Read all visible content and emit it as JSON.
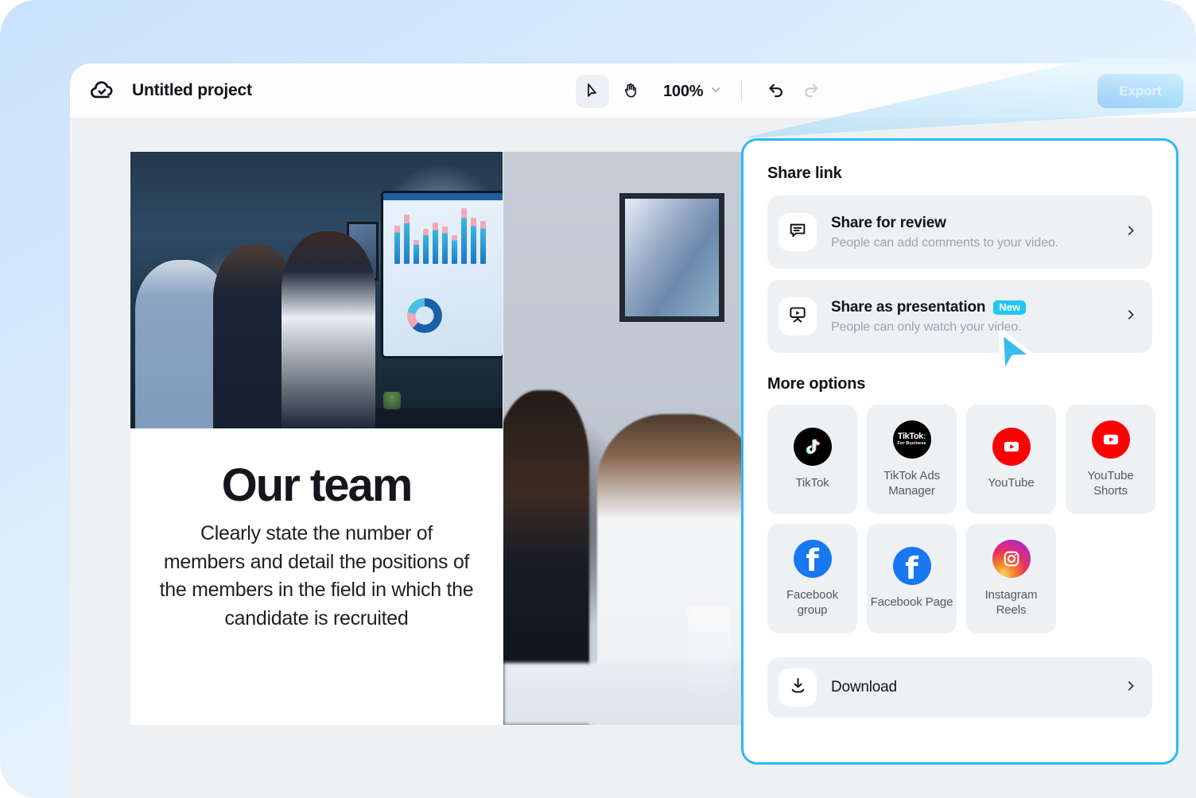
{
  "app": {
    "title": "Untitled project",
    "cloud_icon": "cloud-check-icon"
  },
  "toolbar": {
    "select_tool": "cursor-select-icon",
    "hand_tool": "hand-pan-icon",
    "zoom_value": "100%",
    "zoom_chevron": "chevron-down-icon",
    "undo": "undo-icon",
    "redo": "redo-icon",
    "export_label": "Export"
  },
  "canvas": {
    "slide1": {
      "heading": "Our team",
      "body": "Clearly state the number of members and detail the positions of the members in the field in which the candidate is recruited"
    }
  },
  "share_panel": {
    "heading": "Share link",
    "options": [
      {
        "icon": "comment-bubble-icon",
        "title": "Share for review",
        "subtitle": "People can add comments to your video.",
        "badge": "",
        "chevron": "chevron-right-icon"
      },
      {
        "icon": "presentation-play-icon",
        "title": "Share as presentation",
        "subtitle": "People can only watch your video.",
        "badge": "New",
        "chevron": "chevron-right-icon"
      }
    ],
    "more_options_heading": "More options",
    "social": [
      {
        "icon": "tiktok-icon",
        "label": "TikTok"
      },
      {
        "icon": "tiktok-for-business-icon",
        "label": "TikTok Ads Manager"
      },
      {
        "icon": "youtube-icon",
        "label": "YouTube"
      },
      {
        "icon": "youtube-shorts-icon",
        "label": "YouTube Shorts"
      },
      {
        "icon": "facebook-icon",
        "label": "Facebook group"
      },
      {
        "icon": "facebook-icon",
        "label": "Facebook Page"
      },
      {
        "icon": "instagram-icon",
        "label": "Instagram Reels"
      }
    ],
    "tiktok_ads_logo": {
      "word": "TikTok",
      "dots": ":",
      "tagline": "For Business"
    },
    "facebook_glyph": "f",
    "download": {
      "icon": "download-icon",
      "label": "Download",
      "chevron": "chevron-right-icon"
    }
  },
  "cursor": {
    "icon": "mouse-pointer-icon"
  },
  "colors": {
    "accent_cyan": "#29baf5",
    "badge_new": "#22c5f5",
    "export_blue": "#2196f3",
    "panel_row_bg": "#eef1f4",
    "youtube_red": "#ff0000",
    "facebook_blue": "#1877f2",
    "page_bg": "#d6e9fc"
  }
}
